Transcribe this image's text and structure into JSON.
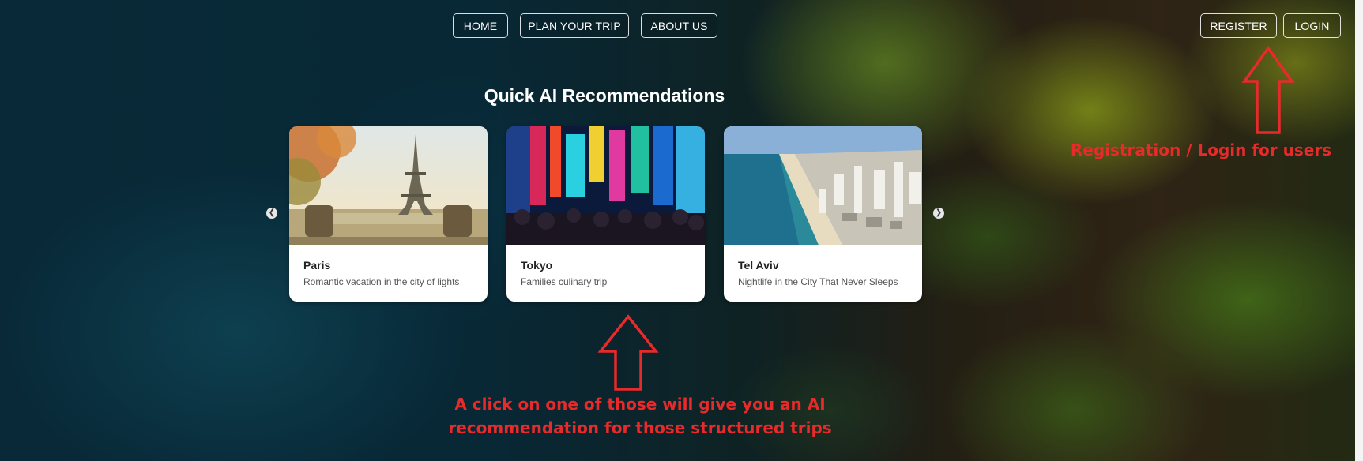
{
  "nav": {
    "home": "HOME",
    "plan_trip": "PLAN YOUR TRIP",
    "about_us": "ABOUT US",
    "register": "REGISTER",
    "login": "LOGIN"
  },
  "section": {
    "title": "Quick AI Recommendations"
  },
  "cards": [
    {
      "name": "Paris",
      "description": "Romantic vacation in the city of lights"
    },
    {
      "name": "Tokyo",
      "description": "Families culinary trip"
    },
    {
      "name": "Tel Aviv",
      "description": "Nightlife in the City That Never Sleeps"
    }
  ],
  "carousel": {
    "prev_icon": "chevron-left-icon",
    "next_icon": "chevron-right-icon"
  },
  "annotations": {
    "login_note": "Registration / Login for users",
    "cards_note_line1": "A click on one of those will give you an AI",
    "cards_note_line2": "recommendation for those structured trips"
  },
  "colors": {
    "annotation_red": "#e82a2a",
    "nav_border": "#ffffff",
    "card_bg": "#ffffff"
  }
}
